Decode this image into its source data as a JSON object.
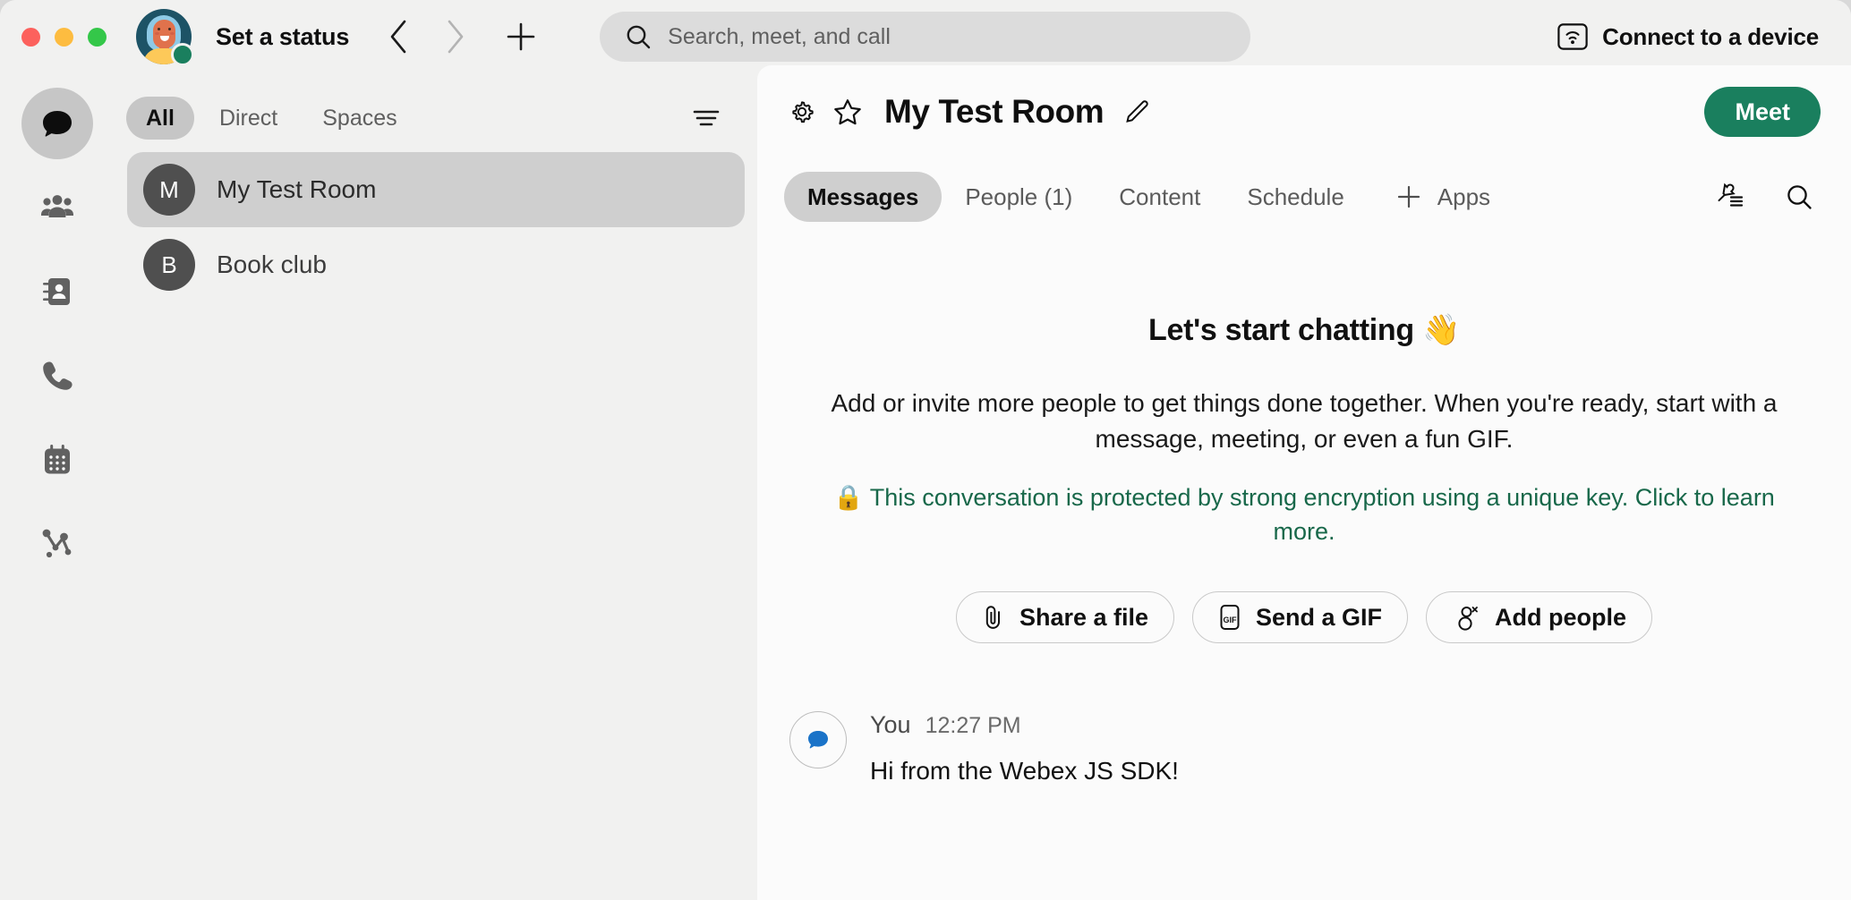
{
  "window": {
    "traffic_lights": [
      "close",
      "minimize",
      "zoom"
    ],
    "status_label": "Set a status"
  },
  "titlebar": {
    "back_icon": "chevron-left-icon",
    "forward_icon": "chevron-right-icon",
    "new_icon": "plus-icon",
    "search": {
      "icon": "search-icon",
      "placeholder": "Search, meet, and call",
      "value": ""
    },
    "connect": {
      "icon": "connect-device-icon",
      "label": "Connect to a device"
    }
  },
  "rail": {
    "items": [
      {
        "name": "messaging",
        "icon": "speech-bubble-icon",
        "active": true
      },
      {
        "name": "teams",
        "icon": "people-group-icon",
        "active": false
      },
      {
        "name": "contacts",
        "icon": "address-book-icon",
        "active": false
      },
      {
        "name": "calling",
        "icon": "phone-icon",
        "active": false
      },
      {
        "name": "meetings",
        "icon": "calendar-icon",
        "active": false
      },
      {
        "name": "insights",
        "icon": "network-graph-icon",
        "active": false
      }
    ]
  },
  "spacelist": {
    "filters": [
      {
        "label": "All",
        "active": true
      },
      {
        "label": "Direct",
        "active": false
      },
      {
        "label": "Spaces",
        "active": false
      }
    ],
    "filter_icon": "sort-filter-icon",
    "rooms": [
      {
        "initial": "M",
        "name": "My Test Room",
        "selected": true
      },
      {
        "initial": "B",
        "name": "Book club",
        "selected": false
      }
    ]
  },
  "room": {
    "settings_icon": "gear-icon",
    "favorite_icon": "star-outline-icon",
    "title": "My Test Room",
    "edit_icon": "pencil-icon",
    "meet_label": "Meet",
    "tabs": [
      {
        "label": "Messages",
        "active": true
      },
      {
        "label": "People (1)",
        "active": false
      },
      {
        "label": "Content",
        "active": false
      },
      {
        "label": "Schedule",
        "active": false
      }
    ],
    "apps": {
      "icon": "plus-icon",
      "label": "Apps"
    },
    "tools": [
      {
        "name": "pinned-messages",
        "icon": "pin-list-icon"
      },
      {
        "name": "search-in-space",
        "icon": "search-icon"
      }
    ]
  },
  "empty_state": {
    "title": "Let's start chatting 👋",
    "subtitle": "Add or invite more people to get things done together. When you're ready, start with a message, meeting, or even a fun GIF.",
    "encryption_emoji": "🔒",
    "encryption_text": "This conversation is protected by strong encryption using a unique key. Click to learn more.",
    "encryption_color": "#18684a",
    "actions": [
      {
        "icon": "paperclip-icon",
        "label": "Share a file"
      },
      {
        "icon": "gif-icon",
        "label": "Send a GIF"
      },
      {
        "icon": "add-person-icon",
        "label": "Add people"
      }
    ]
  },
  "messages": [
    {
      "avatar_icon": "bot-bubble-icon",
      "author": "You",
      "time": "12:27 PM",
      "text": "Hi from the Webex JS SDK!"
    }
  ],
  "colors": {
    "accent_green": "#1a7f5e",
    "encryption_green": "#18684a",
    "chrome_bg": "#f1f1f0",
    "panel_bg": "#fbfbfb",
    "selected_gray": "#cfcfcf",
    "bot_blue": "#1a73c8"
  }
}
